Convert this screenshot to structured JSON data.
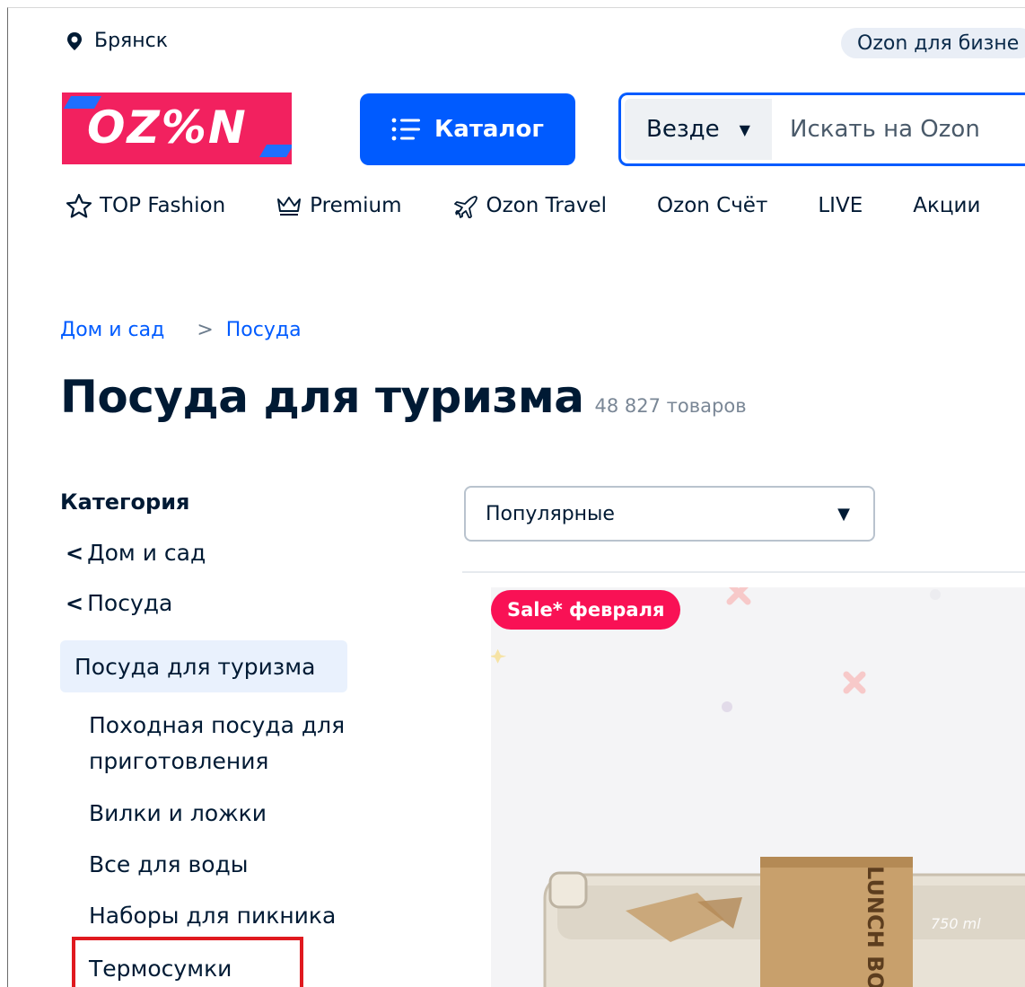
{
  "header": {
    "city": "Брянск",
    "business_link": "Ozon для бизне",
    "logo_text": "OZ%N",
    "catalog_label": "Каталог",
    "search_scope": "Везде",
    "search_placeholder": "Искать на Ozon"
  },
  "nav": {
    "items": [
      {
        "label": "TOP Fashion",
        "icon": "star-icon"
      },
      {
        "label": "Premium",
        "icon": "crown-icon"
      },
      {
        "label": "Ozon Travel",
        "icon": "plane-icon"
      },
      {
        "label": "Ozon Счёт"
      },
      {
        "label": "LIVE"
      },
      {
        "label": "Акции"
      }
    ]
  },
  "breadcrumbs": [
    "Дом и сад",
    "Посуда"
  ],
  "page": {
    "title": "Посуда для туризма",
    "count": "48 827 товаров"
  },
  "sidebar": {
    "heading": "Категория",
    "back_links": [
      "Дом и сад",
      "Посуда"
    ],
    "active": "Посуда для туризма",
    "subcategories": [
      "Походная посуда для приготовления",
      "Вилки и ложки",
      "Все для воды",
      "Наборы для пикника",
      "Термосумки"
    ]
  },
  "sort": {
    "selected": "Популярные"
  },
  "product": {
    "badge": "Sale* февраля",
    "box_label": "LUNCH BOX",
    "volume": "750 ml"
  },
  "colors": {
    "brand_blue": "#005bff",
    "brand_pink": "#f2215f",
    "sale_pink": "#f91155",
    "highlight_red": "#e0191f"
  }
}
